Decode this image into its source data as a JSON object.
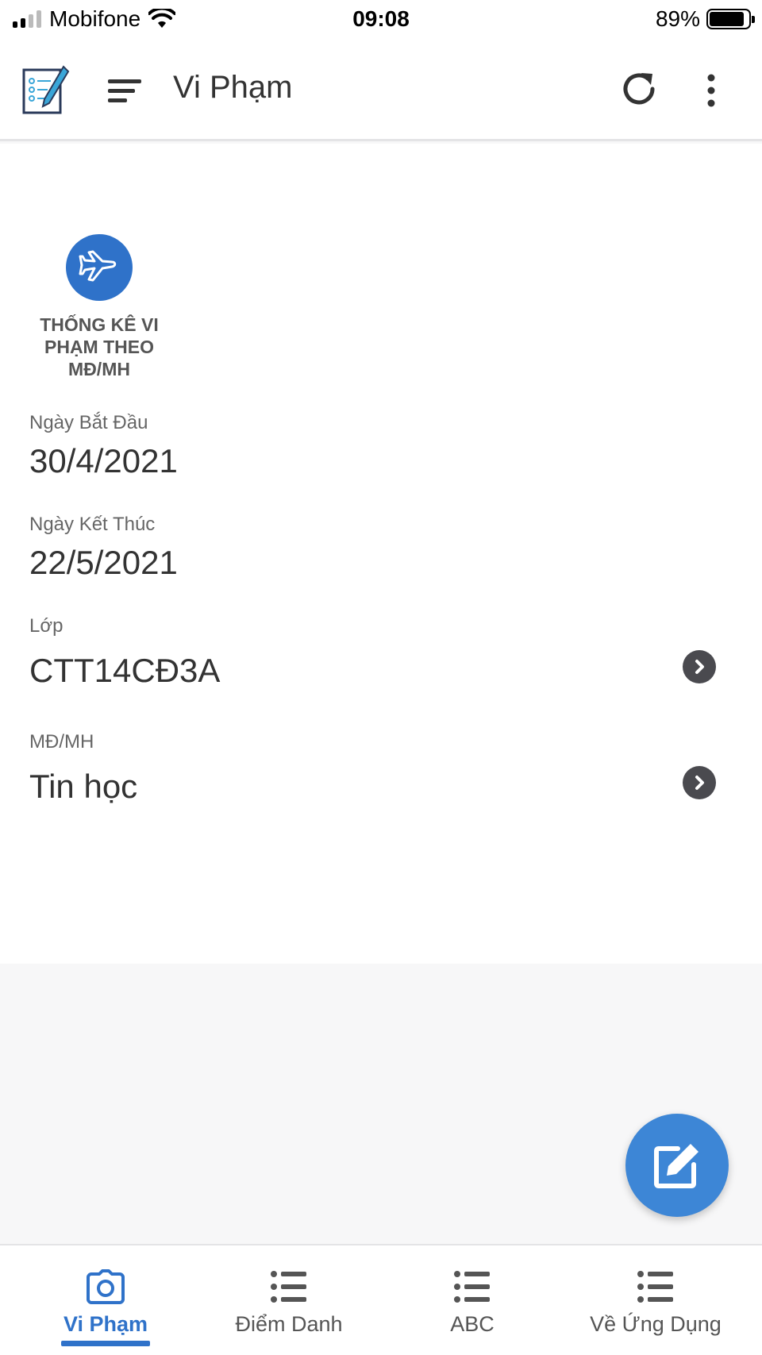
{
  "status_bar": {
    "carrier": "Mobifone",
    "time": "09:08",
    "battery": "89%",
    "battery_level": 0.89
  },
  "app_bar": {
    "title": "Vi Phạm"
  },
  "stat_tile": {
    "label": "THỐNG KÊ VI PHẠM THEO MĐ/MH",
    "icon": "airplane-icon"
  },
  "fields": {
    "start_date": {
      "label": "Ngày Bắt Đầu",
      "value": "30/4/2021"
    },
    "end_date": {
      "label": "Ngày Kết Thúc",
      "value": "22/5/2021"
    },
    "class": {
      "label": "Lớp",
      "value": "CTT14CĐ3A"
    },
    "subject": {
      "label": "MĐ/MH",
      "value": "Tin học"
    }
  },
  "bottom_nav": {
    "items": [
      {
        "label": "Vi Phạm",
        "icon": "camera-icon",
        "active": true
      },
      {
        "label": "Điểm Danh",
        "icon": "list-icon",
        "active": false
      },
      {
        "label": "ABC",
        "icon": "list-icon",
        "active": false
      },
      {
        "label": "Về Ứng Dụng",
        "icon": "list-icon",
        "active": false
      }
    ]
  },
  "colors": {
    "accent": "#2f72c9",
    "fab": "#3d86d6",
    "chevron": "#4a4a4f",
    "background": "#f7f7f8"
  }
}
